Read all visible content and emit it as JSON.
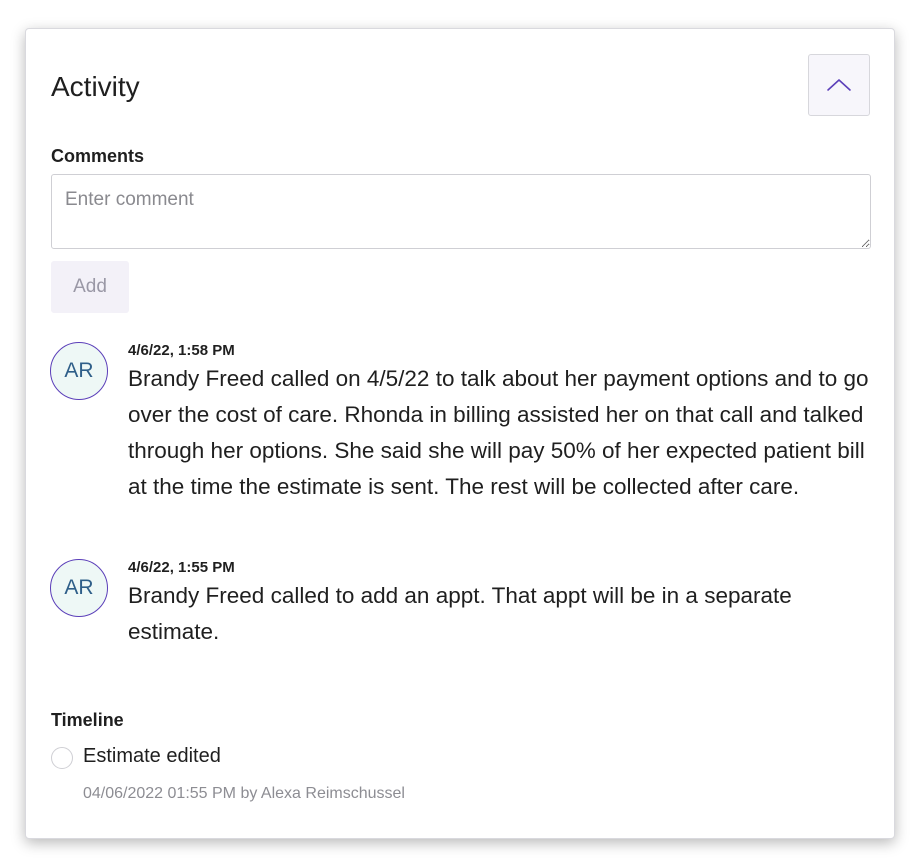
{
  "activity": {
    "title": "Activity",
    "collapse_icon": "chevron-up-icon"
  },
  "comments": {
    "label": "Comments",
    "input_placeholder": "Enter comment",
    "input_value": "",
    "add_label": "Add",
    "items": [
      {
        "initials": "AR",
        "timestamp": "4/6/22, 1:58 PM",
        "text": "Brandy Freed called on 4/5/22 to talk about her payment options and to go over the cost of care. Rhonda in billing assisted her on that call and talked through her options. She said she will pay 50% of her expected patient bill at the time the estimate is sent. The rest will be collected after care."
      },
      {
        "initials": "AR",
        "timestamp": "4/6/22, 1:55 PM",
        "text": "Brandy Freed called to add an appt. That appt will be in a separate estimate."
      }
    ]
  },
  "timeline": {
    "label": "Timeline",
    "items": [
      {
        "title": "Estimate edited",
        "meta": "04/06/2022 01:55 PM by Alexa Reimschussel"
      }
    ]
  },
  "colors": {
    "avatar_border": "#5b3fb9",
    "avatar_bg": "#eef8f6",
    "avatar_text": "#2f5f89",
    "chevron": "#5b3fb9"
  }
}
